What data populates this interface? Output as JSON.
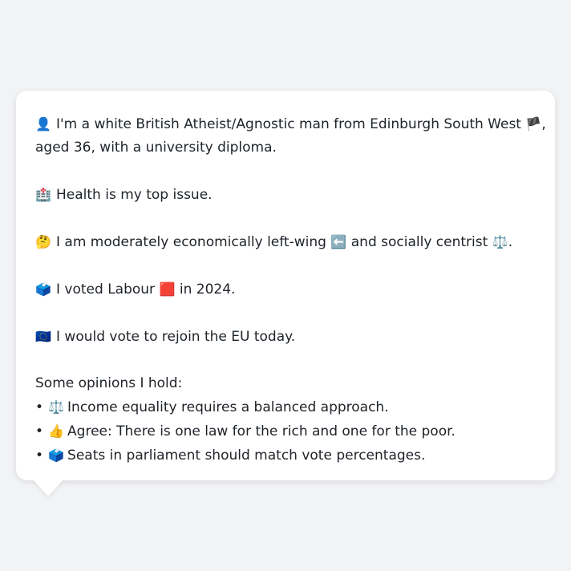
{
  "profile": {
    "intro_line1_icon": "👤",
    "intro_line1": "I'm a white British Atheist/Agnostic man from Edinburgh South West",
    "intro_flag": "🏴",
    "intro_line1_end": ",",
    "intro_line2": "aged 36, with a university diploma.",
    "health_icon": "🏥",
    "health": "Health is my top issue.",
    "thinking_icon": "🤔",
    "ideology_a": "I am moderately economically left-wing",
    "left_arrow_icon": "⬅️",
    "ideology_b": "and socially centrist",
    "scale_icon": "⚖️",
    "ideology_end": ".",
    "ballot_icon": "🗳️",
    "vote_a": "I voted Labour",
    "labour_icon": "🟥",
    "vote_b": "in 2024.",
    "eu_icon": "🇪🇺",
    "eu": "I would vote to rejoin the EU today."
  },
  "opinions": {
    "heading": "Some opinions I hold:",
    "bullet": "•",
    "items": [
      {
        "icon": "⚖️",
        "text": "Income equality requires a balanced approach."
      },
      {
        "icon": "👍",
        "text": "Agree: There is one law for the rich and one for the poor."
      },
      {
        "icon": "🗳️",
        "text": "Seats in parliament should match vote percentages."
      }
    ]
  }
}
